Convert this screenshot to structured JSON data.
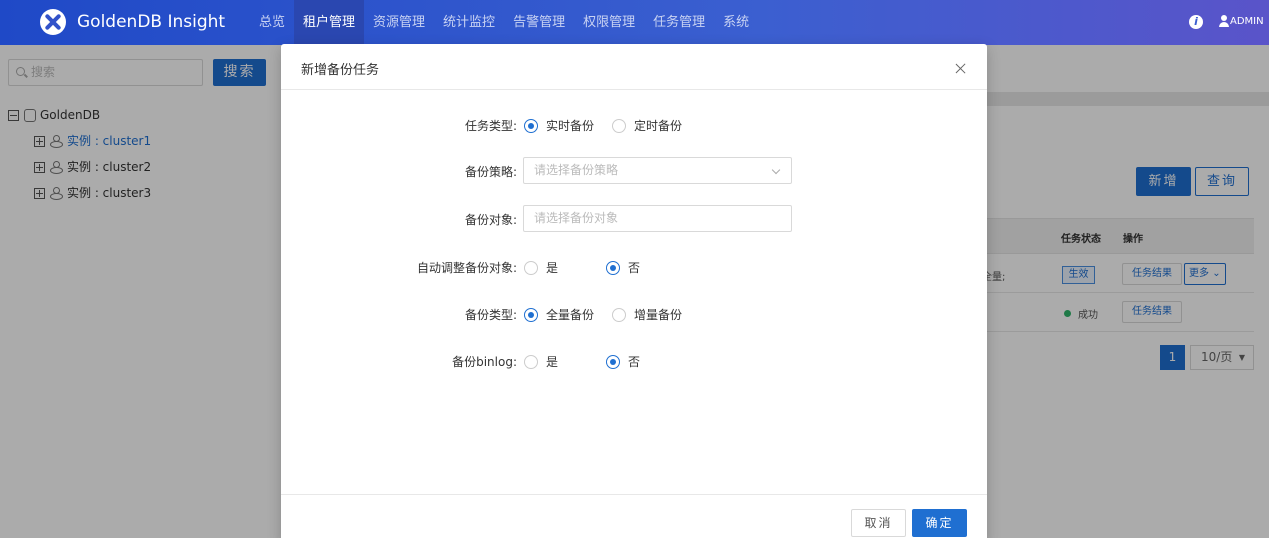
{
  "header": {
    "brand": "GoldenDB Insight",
    "nav": [
      "总览",
      "租户管理",
      "资源管理",
      "统计监控",
      "告警管理",
      "权限管理",
      "任务管理",
      "系统"
    ],
    "active_nav_index": 1,
    "user": "ADMIN"
  },
  "sidebar": {
    "search_placeholder": "搜索",
    "search_button": "搜索",
    "tree_root": "GoldenDB",
    "tree_children": [
      "实例 : cluster1",
      "实例 : cluster2",
      "实例 : cluster3"
    ],
    "selected_index": 0
  },
  "main": {
    "add_button": "新增",
    "query_button": "查询",
    "columns": [
      "任务状态",
      "操作"
    ],
    "row1": {
      "partial_text": "全量;",
      "status_tag": "生效",
      "result_button": "任务结果",
      "more_button": "更多"
    },
    "row2": {
      "status": "成功",
      "result_button": "任务结果"
    },
    "pagination": {
      "current_page": "1",
      "page_size": "10/页"
    }
  },
  "modal": {
    "title": "新增备份任务",
    "fields": {
      "task_type": {
        "label": "任务类型:",
        "options": [
          "实时备份",
          "定时备份"
        ],
        "selected": 0
      },
      "backup_strategy": {
        "label": "备份策略:",
        "placeholder": "请选择备份策略"
      },
      "backup_object": {
        "label": "备份对象:",
        "placeholder": "请选择备份对象"
      },
      "auto_adjust": {
        "label": "自动调整备份对象:",
        "options": [
          "是",
          "否"
        ],
        "selected": 1
      },
      "backup_type": {
        "label": "备份类型:",
        "options": [
          "全量备份",
          "增量备份"
        ],
        "selected": 0
      },
      "backup_binlog": {
        "label": "备份binlog:",
        "options": [
          "是",
          "否"
        ],
        "selected": 1
      }
    },
    "cancel": "取消",
    "confirm": "确定"
  }
}
